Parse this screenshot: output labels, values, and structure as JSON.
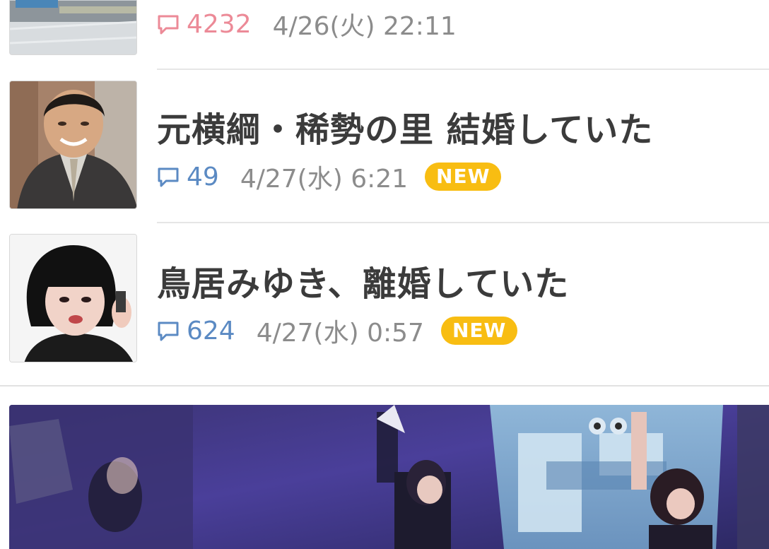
{
  "articles": [
    {
      "comment_count": "4232",
      "date": "4/26(火) 22:11"
    },
    {
      "title": "元横綱・稀勢の里 結婚していた",
      "comment_count": "49",
      "date": "4/27(水) 6:21",
      "badge": "NEW"
    },
    {
      "title": "鳥居みゆき、離婚していた",
      "comment_count": "624",
      "date": "4/27(水) 0:57",
      "badge": "NEW"
    }
  ],
  "colors": {
    "hot_count": "#ec8a97",
    "count": "#5b8ac3",
    "date": "#8c8c8c",
    "badge": "#f8bd12",
    "title": "#3b3b3b"
  },
  "icons": {
    "comment": "comment-bubble-icon"
  }
}
